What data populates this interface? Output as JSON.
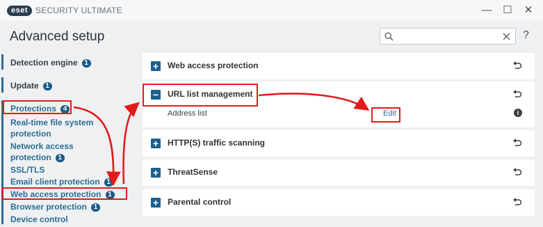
{
  "window": {
    "brand": "eset",
    "product": "SECURITY ULTIMATE",
    "minimize_glyph": "—",
    "maximize_glyph": "☐",
    "close_glyph": "✕"
  },
  "header": {
    "title": "Advanced setup",
    "search_placeholder": "",
    "help_glyph": "?"
  },
  "sidebar": {
    "detection_engine": {
      "label": "Detection engine",
      "badge": "1"
    },
    "update": {
      "label": "Update",
      "badge": "1"
    },
    "protections": {
      "label": "Protections",
      "badge": "4"
    },
    "realtime_1": "Real-time file system",
    "realtime_2": "protection",
    "network_1": "Network access",
    "network_2": "protection",
    "network_badge": "1",
    "ssl": "SSL/TLS",
    "email": {
      "label": "Email client protection",
      "badge": "1"
    },
    "web": {
      "label": "Web access protection",
      "badge": "1"
    },
    "browser": {
      "label": "Browser protection",
      "badge": "1"
    },
    "device": "Device control"
  },
  "panels": {
    "web_access": {
      "title": "Web access protection",
      "icon": "plus-icon"
    },
    "url_list": {
      "title": "URL list management",
      "icon": "minus-icon",
      "address_label": "Address list",
      "edit_label": "Edit",
      "info_icon": "i"
    },
    "https": {
      "title": "HTTP(S) traffic scanning",
      "icon": "plus-icon"
    },
    "threatsense": {
      "title": "ThreatSense",
      "icon": "plus-icon"
    },
    "parental": {
      "title": "Parental control",
      "icon": "plus-icon"
    }
  },
  "colors": {
    "accent": "#2a6d92",
    "badge": "#1f5a86",
    "highlight": "#e21b1b"
  }
}
